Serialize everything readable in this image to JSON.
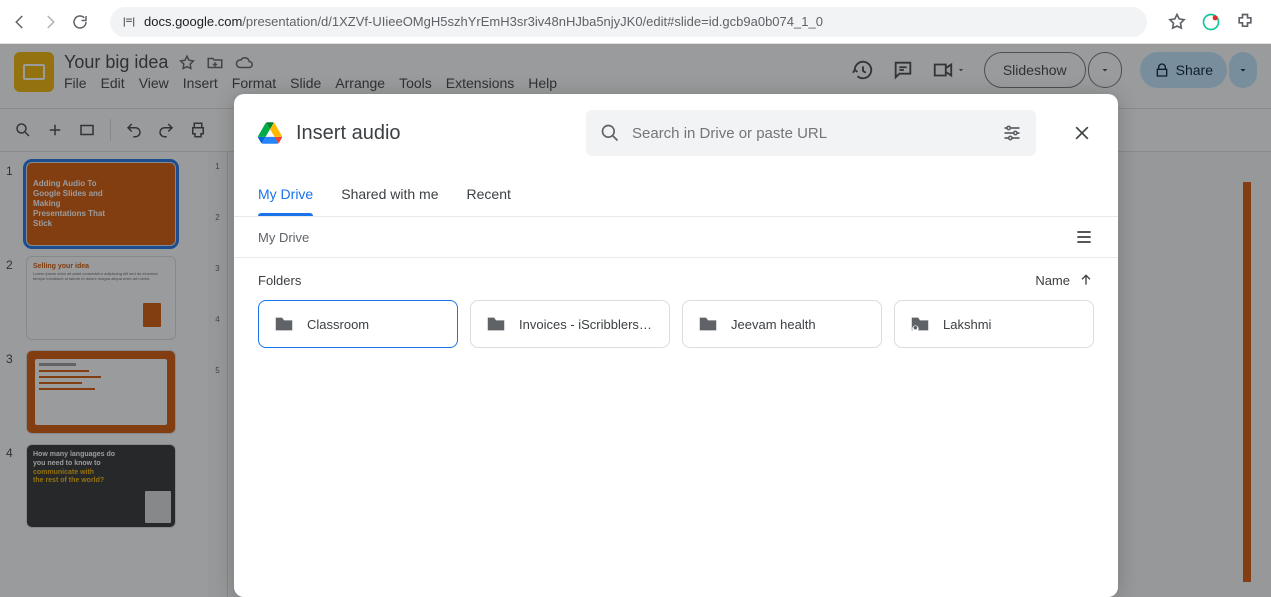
{
  "browser": {
    "url_prefix": "docs.google.com",
    "url_rest": "/presentation/d/1XZVf-UIieeOMgH5szhYrEmH3sr3iv48nHJba5njyJK0/edit#slide=id.gcb9a0b074_1_0"
  },
  "slides": {
    "title": "Your big idea",
    "menus": [
      "File",
      "Edit",
      "View",
      "Insert",
      "Format",
      "Slide",
      "Arrange",
      "Tools",
      "Extensions",
      "Help"
    ],
    "slideshow_label": "Slideshow",
    "share_label": "Share",
    "thumbs": [
      {
        "num": "1",
        "line1": "Adding Audio To",
        "line2": "Google Slides and",
        "line3": "Making",
        "line4": "Presentations That",
        "line5": "Stick"
      },
      {
        "num": "2",
        "title": "Selling your idea"
      },
      {
        "num": "3"
      },
      {
        "num": "4",
        "l1": "How many languages do",
        "l2": "you need to know to",
        "l3": "communicate with",
        "l4": "the rest of the world?"
      }
    ],
    "ruler": [
      "1",
      "2",
      "3",
      "4",
      "5"
    ]
  },
  "dialog": {
    "title": "Insert audio",
    "search_placeholder": "Search in Drive or paste URL",
    "tabs": [
      {
        "label": "My Drive",
        "active": true
      },
      {
        "label": "Shared with me",
        "active": false
      },
      {
        "label": "Recent",
        "active": false
      }
    ],
    "breadcrumb": "My Drive",
    "section_label": "Folders",
    "sort_label": "Name",
    "folders": [
      {
        "name": "Classroom",
        "selected": true,
        "icon": "folder"
      },
      {
        "name": "Invoices - iScribblers…",
        "selected": false,
        "icon": "folder"
      },
      {
        "name": "Jeevam health",
        "selected": false,
        "icon": "folder"
      },
      {
        "name": "Lakshmi",
        "selected": false,
        "icon": "shared"
      }
    ]
  }
}
